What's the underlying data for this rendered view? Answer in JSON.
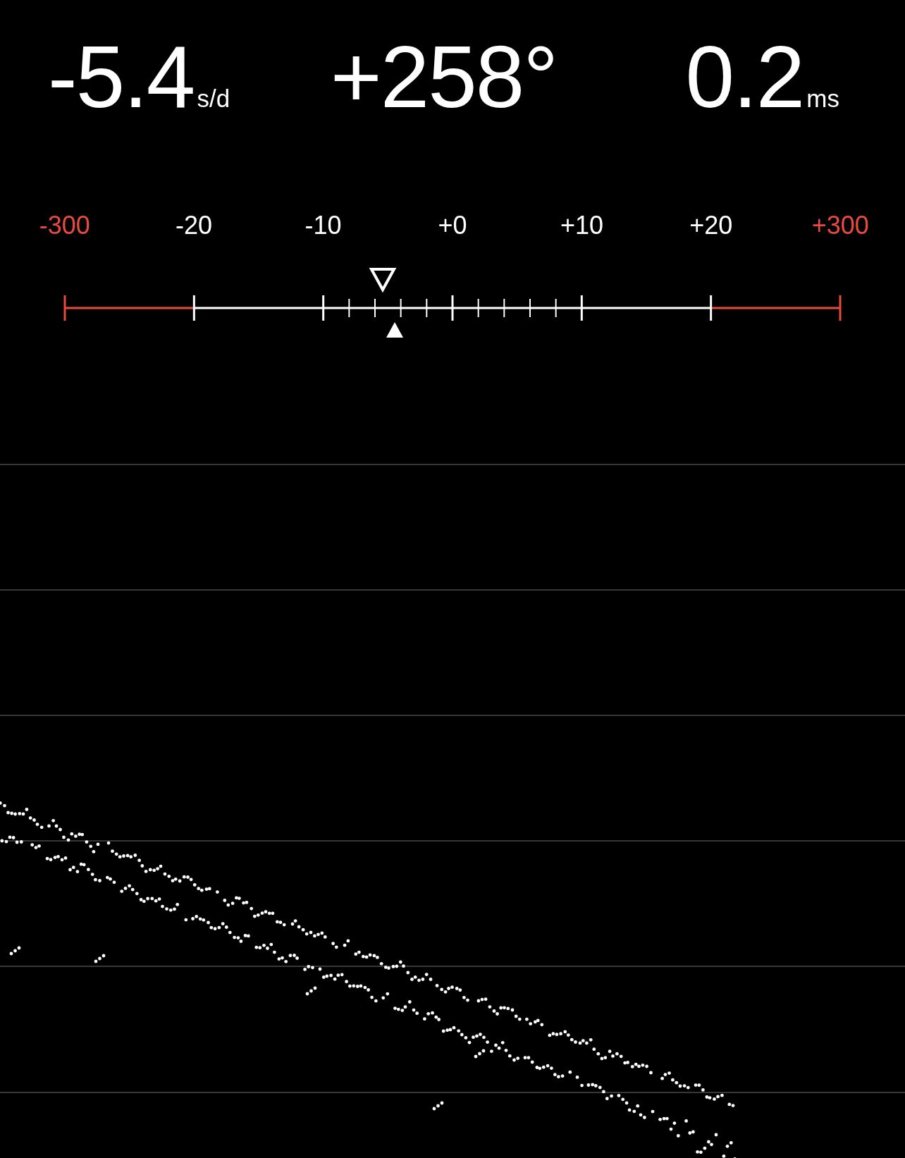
{
  "readings": [
    {
      "value": "-5.4",
      "unit": "s/d"
    },
    {
      "value": "+258°"
    },
    {
      "value": "0.2",
      "unit": "ms"
    }
  ],
  "scale": {
    "labels": [
      {
        "text": "-300",
        "color": "#e84a3f"
      },
      {
        "text": "-20",
        "color": "#ffffff"
      },
      {
        "text": "-10",
        "color": "#ffffff"
      },
      {
        "text": "+0",
        "color": "#ffffff"
      },
      {
        "text": "+10",
        "color": "#ffffff"
      },
      {
        "text": "+20",
        "color": "#ffffff"
      },
      {
        "text": "+300",
        "color": "#e84a3f"
      }
    ],
    "segments": [
      {
        "kind": "limit"
      },
      {
        "kind": "plain"
      },
      {
        "kind": "fine"
      },
      {
        "kind": "fine"
      },
      {
        "kind": "plain"
      },
      {
        "kind": "limit"
      }
    ],
    "markers": [
      {
        "kind": "outline",
        "level": 0.41
      },
      {
        "kind": "filled",
        "level": 0.4255
      }
    ]
  }
}
